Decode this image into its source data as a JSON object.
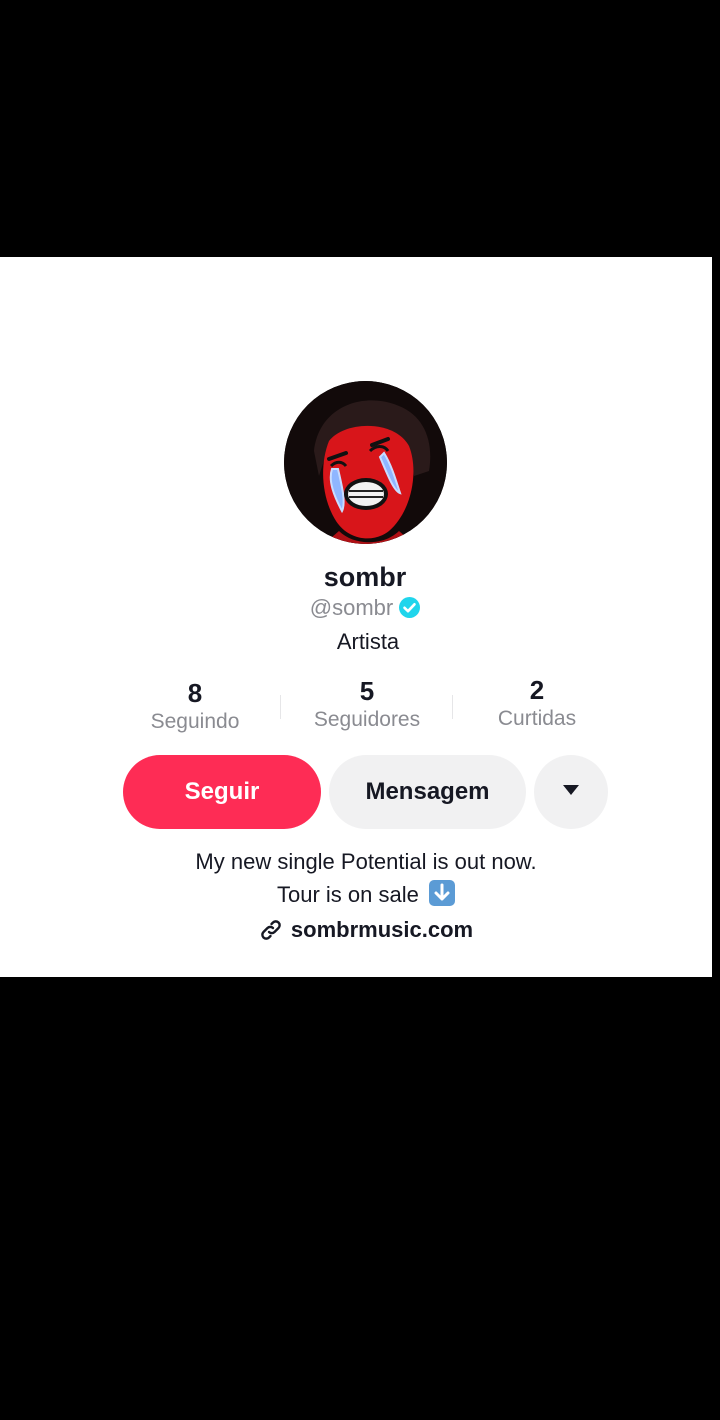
{
  "profile": {
    "display_name": "sombr",
    "handle": "@sombr",
    "verified_icon": "verified-badge-icon",
    "category": "Artista"
  },
  "stats": {
    "following": {
      "value": "8",
      "label": "Seguindo"
    },
    "followers": {
      "value": "5",
      "label": "Seguidores"
    },
    "likes": {
      "value": "2",
      "label": "Curtidas"
    }
  },
  "actions": {
    "follow_label": "Seguir",
    "message_label": "Mensagem",
    "more_icon": "caret-down-icon"
  },
  "bio": {
    "line1": "My new single Potential is out now.",
    "line2": "Tour is on sale",
    "line2_emoji": "down-arrow-emoji-icon",
    "link_icon": "link-icon",
    "link": "sombrmusic.com"
  },
  "colors": {
    "follow_bg": "#fe2c55",
    "secondary_bg": "#f1f1f2",
    "verified": "#20d5ec",
    "muted_text": "#8a8b91",
    "primary_text": "#161823"
  }
}
